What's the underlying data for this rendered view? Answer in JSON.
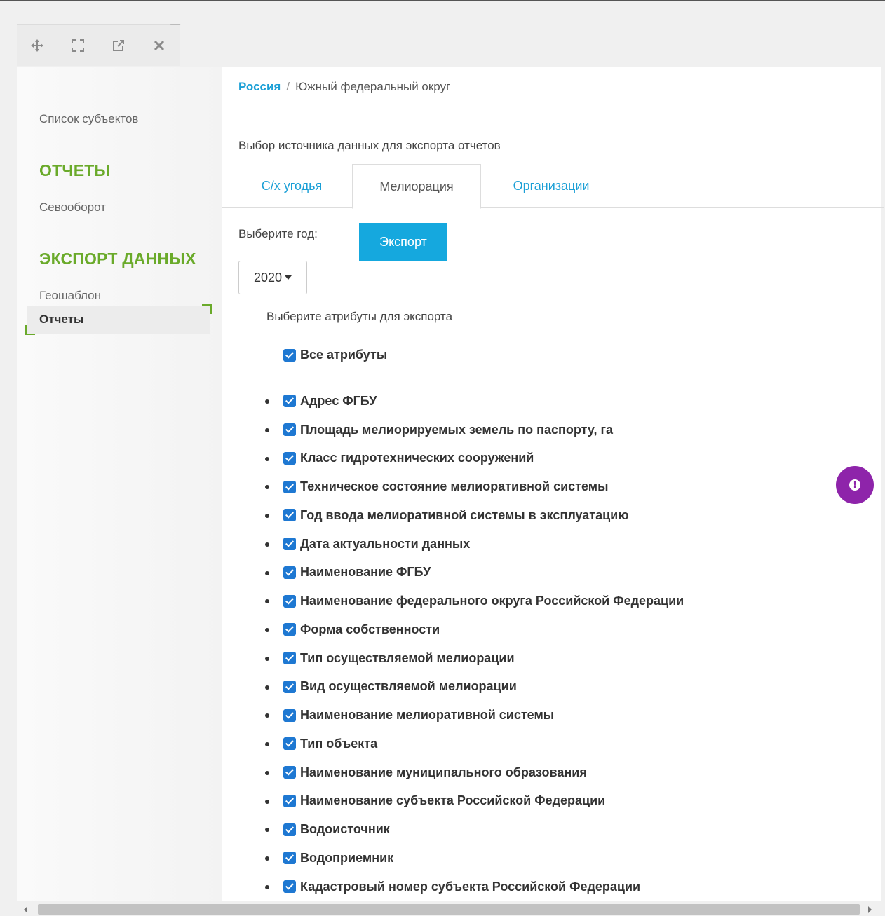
{
  "toolbar": {
    "icons": [
      "move-icon",
      "expand-icon",
      "external-link-icon",
      "close-icon"
    ]
  },
  "sidebar": {
    "subjects_list": "Список субъектов",
    "reports_heading": "ОТЧЕТЫ",
    "crop_rotation": "Севооборот",
    "export_heading": "ЭКСПОРТ ДАННЫХ",
    "geotemplate": "Геошаблон",
    "reports_active": "Отчеты"
  },
  "breadcrumb": {
    "root": "Россия",
    "separator": "/",
    "current": "Южный федеральный округ"
  },
  "source_title": "Выбор источника данных для экспорта отчетов",
  "tabs": [
    "С/х угодья",
    "Мелиорация",
    "Организации"
  ],
  "active_tab": "Мелиорация",
  "year_label": "Выберите год:",
  "export_button": "Экспорт",
  "year_select": {
    "value": "2020"
  },
  "attrs_title": "Выберите атрибуты для экспорта",
  "all_attrs": {
    "label": "Все атрибуты",
    "checked": true
  },
  "attributes": [
    "Адрес ФГБУ",
    "Площадь мелиорируемых земель по паспорту, га",
    "Класс гидротехнических сооружений",
    "Техническое состояние мелиоративной системы",
    "Год ввода мелиоративной системы в эксплуатацию",
    "Дата актуальности данных",
    "Наименование ФГБУ",
    "Наименование федерального округа Российской Федерации",
    "Форма собственности",
    "Тип осуществляемой мелиорации",
    "Вид осуществляемой мелиорации",
    "Наименование мелиоративной системы",
    "Тип объекта",
    "Наименование муниципального образования",
    "Наименование субъекта Российской Федерации",
    "Водоисточник",
    "Водоприемник",
    "Кадастровый номер субъекта Российской Федерации"
  ],
  "colors": {
    "accent_green": "#6aaa2a",
    "link_blue": "#1a9fd6",
    "button_blue": "#15a8de",
    "checkbox_blue": "#1e78d2",
    "help_purple": "#8e24aa"
  }
}
